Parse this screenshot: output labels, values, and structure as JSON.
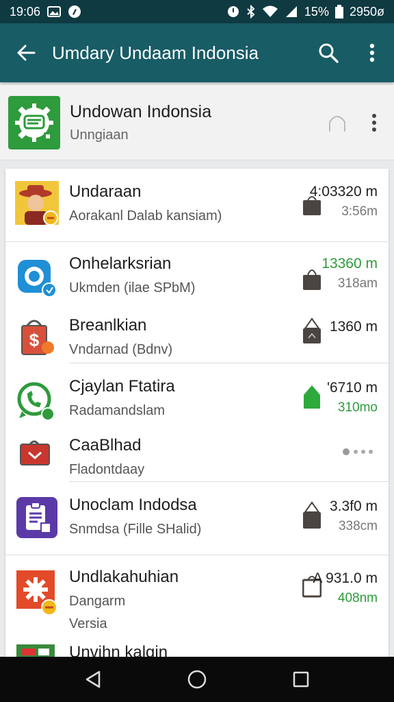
{
  "status_bar": {
    "time": "19:06",
    "battery_percent": "15%",
    "extra": "2950ø",
    "icons": [
      "gallery-icon",
      "circle-app-icon",
      "alarm-icon",
      "bluetooth-icon",
      "wifi-icon",
      "signal-icon",
      "battery-icon"
    ]
  },
  "app_bar": {
    "title": "Umdary Undaam Indonsia",
    "icons": [
      "back-arrow-icon",
      "search-icon",
      "more-vert-icon"
    ]
  },
  "header_card": {
    "title": "Undowan Indonsia",
    "subtitle": "Unngiaan",
    "icon": "gear-badge-icon",
    "button_icon": "chevron-up-icon",
    "more_icon": "more-vert-icon"
  },
  "apps": [
    {
      "title": "Undaraan",
      "subtitle": "Aorakanl Dalab kansiam)",
      "size": "03320 m",
      "size_prefix": "4:",
      "size2": "3:56m",
      "icon": "cowboy-avatar-icon",
      "accent": "#f2c63a",
      "bag": "dark"
    },
    {
      "title": "Onhelarksrian",
      "subtitle": "Ukmden (ilae SPbM)",
      "size": "13360 m",
      "size2": "318am",
      "icon": "blue-circle-app-icon",
      "accent": "#1f8fd6",
      "bag": "dark"
    },
    {
      "title": "Breanlkian",
      "subtitle": "Vndarnad (Bdnv)",
      "size": "1360 m",
      "size2": "",
      "icon": "shopping-bag-dollar-icon",
      "accent": "#d9503a",
      "bag": "dark-open"
    },
    {
      "title": "Cjaylan Ftatira",
      "subtitle": "Radamandslam",
      "size": "'6710 m",
      "size2": "310mo",
      "icon": "whatsapp-like-icon",
      "accent": "#2e9b3c",
      "bag": "green"
    },
    {
      "title": "CaaBlhad",
      "subtitle": "Fladontdaay",
      "size": "",
      "size2": "",
      "icon": "red-tray-icon",
      "accent": "#c8362e",
      "bag": "dots"
    },
    {
      "title": "Unoclam Indodsa",
      "subtitle": "Snmdsa (Fille SHalid)",
      "size": "3.3f0 m",
      "size2": "338cm",
      "icon": "clipboard-icon",
      "accent": "#5b3aa8",
      "bag": "dark"
    },
    {
      "title": "Undlakahuhian",
      "subtitle": "Dangarm",
      "subtitle2": "Versia",
      "size": "931.0 m",
      "size_prefix": "A",
      "size2": "408nm",
      "icon": "red-gear-icon",
      "accent": "#e24a2a",
      "bag": "dark-square"
    },
    {
      "title": "Unvihn kalgin",
      "subtitle": "",
      "size": "",
      "size2": "",
      "icon": "green-red-app-icon",
      "accent": "#3a8a3a",
      "bag": "none"
    }
  ],
  "nav_bar": {
    "icons": [
      "back-triangle-icon",
      "home-circle-icon",
      "recents-square-icon"
    ]
  },
  "colors": {
    "status_bar": "#0f3a42",
    "app_bar": "#185c66",
    "green": "#2e9b3c",
    "nav_bar": "#0a0a0a"
  }
}
